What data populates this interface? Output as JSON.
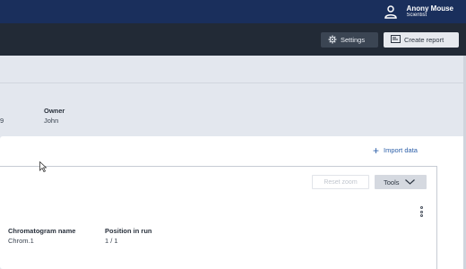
{
  "header": {
    "user_name": "Anony Mouse",
    "user_role": "Scientist",
    "icon": "user-icon"
  },
  "toolbar": {
    "settings_label": "Settings",
    "settings_icon": "gear-icon",
    "create_report_label": "Create report",
    "create_report_icon": "report-icon"
  },
  "info": {
    "clipped_value": "9",
    "owner_label": "Owner",
    "owner_value": "John"
  },
  "card": {
    "import_label": "Import data",
    "import_icon": "plus-icon",
    "reset_zoom_label": "Reset zoom",
    "tools_label": "Tools",
    "tools_icon": "chevron-down-icon",
    "more_icon": "kebab-icon",
    "columns": [
      {
        "label": "Chromatogram name",
        "value": "Chrom.1"
      },
      {
        "label": "Position in run",
        "value": "1 / 1"
      }
    ]
  },
  "colors": {
    "topbar": "#1a2f5c",
    "toolbar": "#222a36",
    "accent": "#2b5ea8"
  }
}
